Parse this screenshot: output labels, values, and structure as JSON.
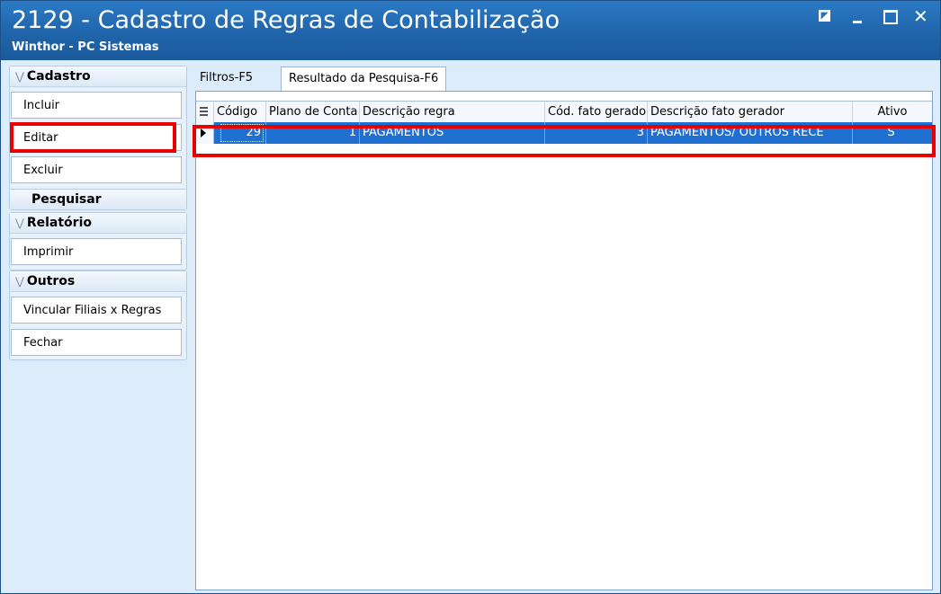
{
  "window": {
    "title": "2129 - Cadastro de Regras de Contabilização",
    "subtitle": "Winthor - PC Sistemas",
    "controls": {
      "restore": "restore-icon",
      "minimize": "minimize-icon",
      "maximize": "maximize-icon",
      "close": "✕"
    }
  },
  "sidebar": {
    "cadastro": {
      "header": "Cadastro",
      "buttons": [
        "Incluir",
        "Editar",
        "Excluir"
      ]
    },
    "pesquisar": {
      "header": "Pesquisar"
    },
    "relatorio": {
      "header": "Relatório",
      "buttons": [
        "Imprimir"
      ]
    },
    "outros": {
      "header": "Outros",
      "buttons": [
        "Vincular Filiais x Regras",
        "Fechar"
      ]
    }
  },
  "tabs": [
    {
      "label": "Filtros-F5",
      "active": false
    },
    {
      "label": "Resultado da Pesquisa-F6",
      "active": true
    }
  ],
  "grid": {
    "columns": [
      "Código",
      "Plano de Conta",
      "Descrição regra",
      "Cód. fato gerador",
      "Descrição fato gerador",
      "Ativo"
    ],
    "rows": [
      {
        "codigo": "29",
        "plano": "1",
        "descricao": "PAGAMENTOS",
        "cod_fato": "3",
        "desc_fato": "PAGAMENTOS/ OUTROS RECE",
        "ativo": "S"
      }
    ]
  },
  "colors": {
    "title_bar": "#1f63a8",
    "selected_row": "#1f6fd0",
    "highlight": "#e60000",
    "panel_bg": "#dcecfa"
  }
}
